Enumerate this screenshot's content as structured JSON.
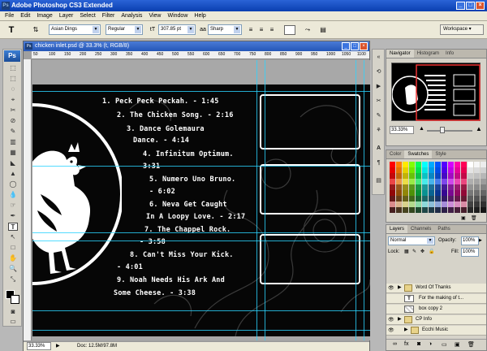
{
  "window": {
    "title": "Adobe Photoshop CS3 Extended",
    "minimize": "_",
    "maximize": "□",
    "close": "×"
  },
  "menu": [
    "File",
    "Edit",
    "Image",
    "Layer",
    "Select",
    "Filter",
    "Analysis",
    "View",
    "Window",
    "Help"
  ],
  "options": {
    "tool_glyph": "T",
    "orient_glyph": "⇅",
    "font_family": "Asian Dings",
    "font_style": "Regular",
    "font_size": "307.85 pt",
    "antialias": "Sharp",
    "workspace": "Workspace ▾"
  },
  "toolbox": {
    "logo": "Ps",
    "tools": [
      "⬚",
      "⬚",
      "◌",
      "⌖",
      "✂",
      "⊘",
      "✎",
      "▥",
      "▦",
      "◣",
      "▲",
      "◯",
      "💧",
      "☞",
      "✒",
      "T",
      "↖",
      "□",
      "✋",
      "🔍",
      "⤡",
      "⬛"
    ]
  },
  "document": {
    "title": "chicken inlet.psd @ 33.3% (t, RGB/8)",
    "ruler_ticks": [
      "50",
      "100",
      "150",
      "200",
      "250",
      "300",
      "350",
      "400",
      "450",
      "500",
      "550",
      "600",
      "650",
      "700",
      "750",
      "800",
      "850",
      "900",
      "950",
      "1000",
      "1050",
      "1100"
    ],
    "zoom": "33.33%",
    "doc_size": "Doc: 12.5M/97.8M"
  },
  "tracks": [
    "1. Peck Peck Peckah. - 1:45",
    "2. The Chicken Song. - 2:16",
    "3. Dance Golemaura",
    "Dance. - 4:14",
    "4. Infinitum Optimum.",
    "3:31",
    "5. Numero Uno Bruno.",
    "- 6:02",
    "6. Neva Get Caught",
    "In A Loopy Love. - 2:17",
    "7. The Chappel Rock.",
    "- 3:58",
    "8. Can't Miss Your Kick.",
    "- 4:01",
    "9. Noah Needs His Ark And",
    "Some Cheese. - 3:38"
  ],
  "navigator": {
    "tabs": [
      "Navigator",
      "Histogram",
      "Info"
    ],
    "zoom": "33.33%"
  },
  "swatches": {
    "tabs": [
      "Color",
      "Swatches",
      "Style"
    ]
  },
  "layers": {
    "tabs": [
      "Layers",
      "Channels",
      "Paths"
    ],
    "blend_mode": "Normal",
    "opacity_label": "Opacity:",
    "opacity": "100%",
    "lock_label": "Lock:",
    "fill_label": "Fill:",
    "fill": "100%",
    "rows": [
      "Word Of Thanks",
      "For the making of t...",
      "box copy 2",
      "CP Info",
      "Ecchi Music"
    ],
    "row_glyphs": [
      "▶",
      "T",
      "",
      "▶",
      "▶"
    ]
  },
  "colors": {
    "guide": "#2ad3ff",
    "titlebar": "#0a3fb0",
    "artboard": "#060606"
  }
}
